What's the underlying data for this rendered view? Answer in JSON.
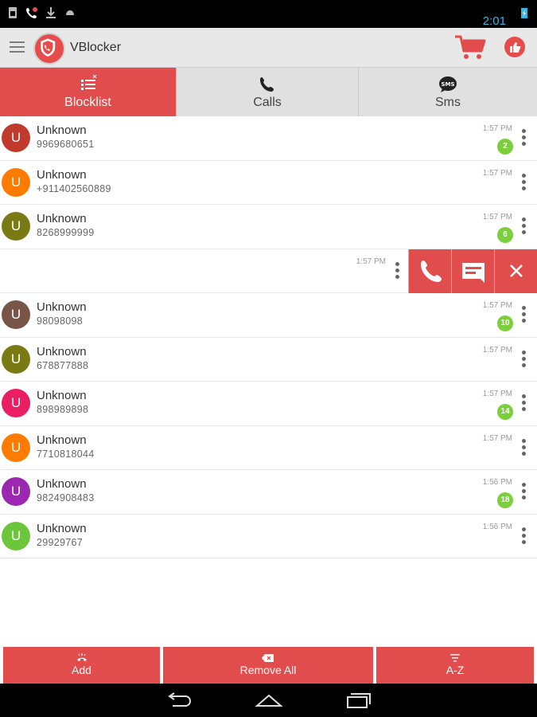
{
  "status_bar": {
    "time": "2:01",
    "time_color": "#33b5e5"
  },
  "app_bar": {
    "title": "VBlocker",
    "menu_icon": "hamburger-icon",
    "cart_icon": "cart-icon",
    "like_icon": "thumbs-up-icon"
  },
  "tabs": [
    {
      "label": "Blocklist",
      "icon": "blocklist-icon",
      "active": true
    },
    {
      "label": "Calls",
      "icon": "phone-icon",
      "active": false
    },
    {
      "label": "Sms",
      "icon": "sms-icon",
      "active": false
    }
  ],
  "rows": [
    {
      "initial": "U",
      "name": "Unknown",
      "number": "9969680651",
      "time": "1:57 PM",
      "badge": "2",
      "color": "#c0392b"
    },
    {
      "initial": "U",
      "name": "Unknown",
      "number": "+911402560889",
      "time": "1:57 PM",
      "badge": "",
      "color": "#ff7b00"
    },
    {
      "initial": "U",
      "name": "Unknown",
      "number": "8268999999",
      "time": "1:57 PM",
      "badge": "6",
      "color": "#7a7a15"
    },
    {
      "initial": "",
      "name": "",
      "number": "",
      "time": "1:57 PM",
      "badge": "",
      "color": "",
      "swiped": true
    },
    {
      "initial": "U",
      "name": "Unknown",
      "number": "98098098",
      "time": "1:57 PM",
      "badge": "10",
      "color": "#795548"
    },
    {
      "initial": "U",
      "name": "Unknown",
      "number": "678877888",
      "time": "1:57 PM",
      "badge": "",
      "color": "#7a7a15"
    },
    {
      "initial": "U",
      "name": "Unknown",
      "number": "898989898",
      "time": "1:57 PM",
      "badge": "14",
      "color": "#e91e63"
    },
    {
      "initial": "U",
      "name": "Unknown",
      "number": "7710818044",
      "time": "1:57 PM",
      "badge": "",
      "color": "#ff7b00"
    },
    {
      "initial": "U",
      "name": "Unknown",
      "number": "9824908483",
      "time": "1:56 PM",
      "badge": "18",
      "color": "#9c27b0"
    },
    {
      "initial": "U",
      "name": "Unknown",
      "number": "29929767",
      "time": "1:56 PM",
      "badge": "",
      "color": "#6cc63b"
    }
  ],
  "swipe_actions": [
    "call-icon",
    "message-icon",
    "close-icon"
  ],
  "bottom_bar": {
    "add": "Add",
    "remove_all": "Remove All",
    "sort": "A-Z"
  },
  "colors": {
    "accent": "#e14d4d",
    "badge": "#7ccf3c"
  }
}
